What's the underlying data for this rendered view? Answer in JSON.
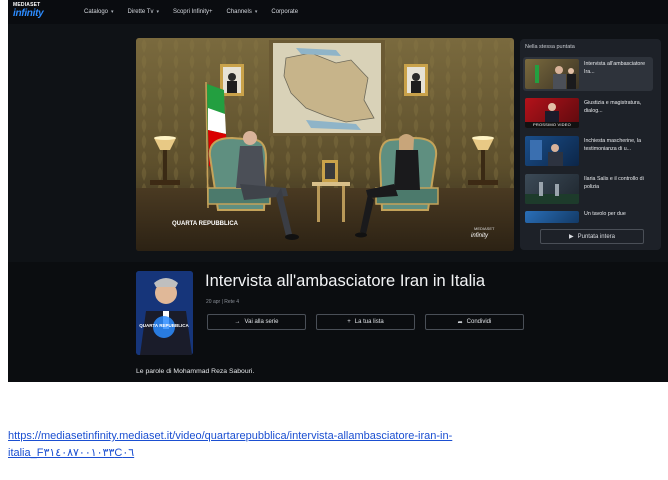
{
  "brand": {
    "top": "MEDIASET",
    "name": "infinity"
  },
  "nav": [
    "Catalogo",
    "Dirette Tv",
    "Scopri Infinity+",
    "Channels",
    "Corporate"
  ],
  "nav_dropdown": [
    true,
    true,
    false,
    true,
    false
  ],
  "player": {
    "logo_left": "QUARTA REPUBBLICA",
    "logo_right": "infinity",
    "watermark_small": "MEDIASET"
  },
  "sidebar": {
    "title": "Nella stessa puntata",
    "items": [
      {
        "text": "Intervista all'ambasciatore Ira...",
        "badge": ""
      },
      {
        "text": "Giustizia e magistratura, dialog...",
        "badge": "PROSSIMO VIDEO"
      },
      {
        "text": "Inchiesta mascherine, la testimonianza di u...",
        "badge": ""
      },
      {
        "text": "Ilaria Salis e il controllo di polizia",
        "badge": ""
      },
      {
        "text": "Un tavolo per due",
        "badge": ""
      }
    ],
    "full_button": "Puntata intera"
  },
  "episode": {
    "title": "Intervista all'ambasciatore Iran in Italia",
    "meta": "20 apr | Rete 4",
    "buttons": {
      "series": "Vai alla serie",
      "list": "La tua lista",
      "share": "Condividi"
    },
    "poster_text": "QUARTA REPUBBLICA",
    "description": "Le parole di Mohammad Reza Sabouri."
  },
  "link": {
    "line1": "https://mediasetinfinity.mediaset.it/video/quartarepubblica/intervista-allambasciatore-iran-in-",
    "line2": "italia_F٣١٤٠٨٧٠٠١٠٣٣C٠٦"
  },
  "colors": {
    "accent": "#2d8cff",
    "background": "#0f1216",
    "link": "#1b4fd1"
  }
}
